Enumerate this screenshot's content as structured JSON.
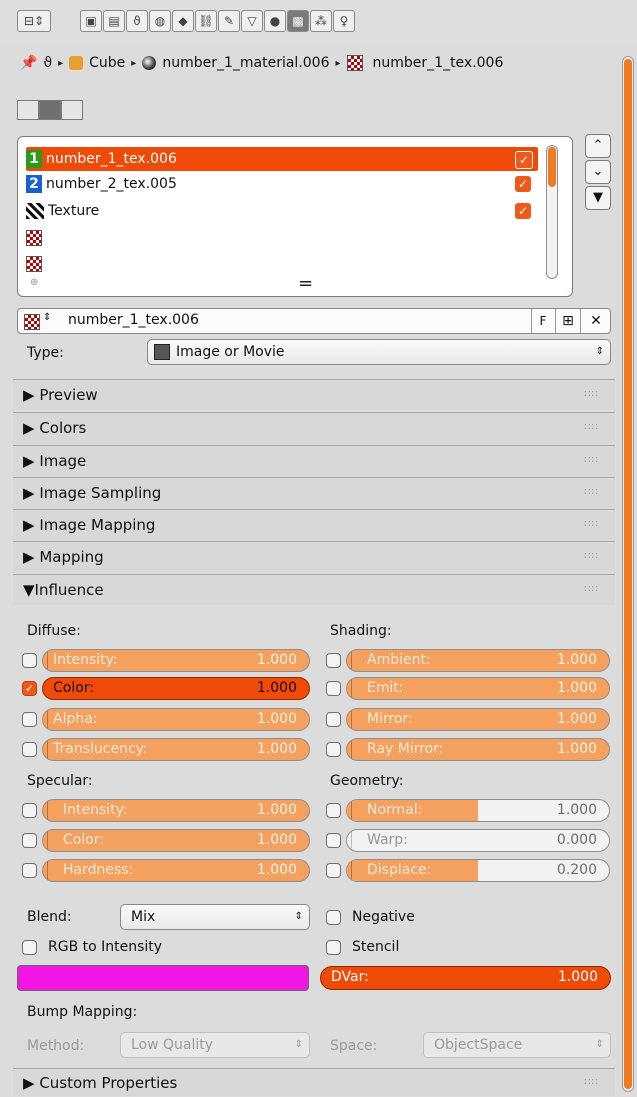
{
  "tabs": [
    {
      "icon": "render-layers-icon"
    },
    {
      "icon": "render-icon"
    },
    {
      "icon": "layers-icon"
    },
    {
      "icon": "scene-icon"
    },
    {
      "icon": "world-icon"
    },
    {
      "icon": "object-icon"
    },
    {
      "icon": "constraints-icon"
    },
    {
      "icon": "modifiers-icon"
    },
    {
      "icon": "data-icon"
    },
    {
      "icon": "material-icon"
    },
    {
      "icon": "texture-icon"
    },
    {
      "icon": "particles-icon"
    },
    {
      "icon": "physics-icon"
    }
  ],
  "breadcrumb": {
    "object": "Cube",
    "material": "number_1_material.006",
    "texture": "number_1_tex.006"
  },
  "slots": [
    {
      "name": "number_1_tex.006",
      "badge": "1",
      "badge_color": "#2a9a1a",
      "selected": true,
      "enabled": true
    },
    {
      "name": "number_2_tex.005",
      "badge": "2",
      "badge_color": "#1a5fd0",
      "selected": false,
      "enabled": true
    },
    {
      "name": "Texture",
      "badge": "",
      "badge_color": "",
      "selected": false,
      "enabled": true
    },
    {
      "name": "",
      "badge": "",
      "selected": false,
      "enabled": false
    },
    {
      "name": "",
      "badge": "",
      "selected": false,
      "enabled": false
    }
  ],
  "list_handle": "=",
  "texture_field": {
    "name": "number_1_tex.006",
    "fake_user": "F"
  },
  "type": {
    "label": "Type:",
    "value": "Image or Movie"
  },
  "panels": [
    {
      "label": "Preview",
      "expanded": false
    },
    {
      "label": "Colors",
      "expanded": false
    },
    {
      "label": "Image",
      "expanded": false
    },
    {
      "label": "Image Sampling",
      "expanded": false
    },
    {
      "label": "Image Mapping",
      "expanded": false
    },
    {
      "label": "Mapping",
      "expanded": false
    },
    {
      "label": "Influence",
      "expanded": true
    }
  ],
  "influence": {
    "diffuse_label": "Diffuse:",
    "shading_label": "Shading:",
    "specular_label": "Specular:",
    "geometry_label": "Geometry:",
    "diffuse": [
      {
        "label": "Intensity:",
        "value": "1.000",
        "checked": false
      },
      {
        "label": "Color:",
        "value": "1.000",
        "checked": true
      },
      {
        "label": "Alpha:",
        "value": "1.000",
        "checked": false
      },
      {
        "label": "Translucency:",
        "value": "1.000",
        "checked": false
      }
    ],
    "shading": [
      {
        "label": "Ambient:",
        "value": "1.000",
        "checked": false
      },
      {
        "label": "Emit:",
        "value": "1.000",
        "checked": false
      },
      {
        "label": "Mirror:",
        "value": "1.000",
        "checked": false
      },
      {
        "label": "Ray Mirror:",
        "value": "1.000",
        "checked": false
      }
    ],
    "specular": [
      {
        "label": "Intensity:",
        "value": "1.000",
        "checked": false
      },
      {
        "label": "Color:",
        "value": "1.000",
        "checked": false
      },
      {
        "label": "Hardness:",
        "value": "1.000",
        "checked": false
      }
    ],
    "geometry": [
      {
        "label": "Normal:",
        "value": "1.000",
        "checked": false,
        "fill": 0.5
      },
      {
        "label": "Warp:",
        "value": "0.000",
        "checked": false,
        "fill": 0
      },
      {
        "label": "Displace:",
        "value": "0.200",
        "checked": false,
        "fill": 0.5
      }
    ],
    "blend_label": "Blend:",
    "blend_value": "Mix",
    "negative_label": "Negative",
    "rgb_to_intensity_label": "RGB to Intensity",
    "stencil_label": "Stencil",
    "color_swatch": "#f216e6",
    "dvar_label": "DVar:",
    "dvar_value": "1.000",
    "bump_label": "Bump Mapping:",
    "method_label": "Method:",
    "method_value": "Low Quality",
    "space_label": "Space:",
    "space_value": "ObjectSpace"
  },
  "custom_properties_label": "Custom Properties",
  "colors": {
    "accent": "#f04a08",
    "slider": "#f4a15f"
  }
}
